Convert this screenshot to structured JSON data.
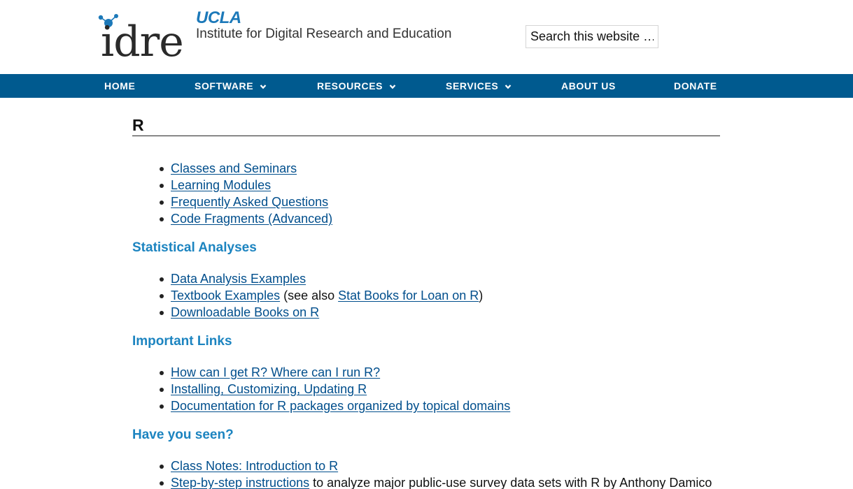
{
  "header": {
    "logo_text": "idre",
    "brand_ucla": "UCLA",
    "brand_institute": "Institute for Digital Research and Education",
    "search_placeholder": "Search this website …"
  },
  "nav": [
    {
      "label": "HOME",
      "has_dropdown": false
    },
    {
      "label": "SOFTWARE",
      "has_dropdown": true
    },
    {
      "label": "RESOURCES",
      "has_dropdown": true
    },
    {
      "label": "SERVICES",
      "has_dropdown": true
    },
    {
      "label": "ABOUT US",
      "has_dropdown": false
    },
    {
      "label": "DONATE",
      "has_dropdown": false
    }
  ],
  "page": {
    "title": "R",
    "top_links": [
      "Classes and Seminars",
      "Learning Modules",
      "Frequently Asked Questions",
      "Code Fragments (Advanced)"
    ],
    "stat": {
      "heading": "Statistical Analyses",
      "items": {
        "data_analysis": "Data Analysis Examples",
        "textbook": "Textbook Examples",
        "textbook_mid": " (see also ",
        "stat_books": "Stat Books for Loan on R",
        "textbook_end": ")",
        "downloadable": "Downloadable Books on R"
      }
    },
    "important": {
      "heading": "Important Links",
      "items": [
        "How can I get R? Where can I run R?",
        "Installing, Customizing, Updating R",
        "Documentation for R packages organized by topical domains"
      ]
    },
    "seen": {
      "heading": "Have you seen?",
      "class_notes": "Class Notes: Introduction to R",
      "step_link": "Step-by-step instructions",
      "step_rest": " to analyze major public-use survey data sets with R by Anthony Damico"
    }
  },
  "colors": {
    "nav_bg": "#005a8f",
    "link": "#004e8c",
    "heading": "#1c84c0",
    "brand": "#1c79b9"
  }
}
